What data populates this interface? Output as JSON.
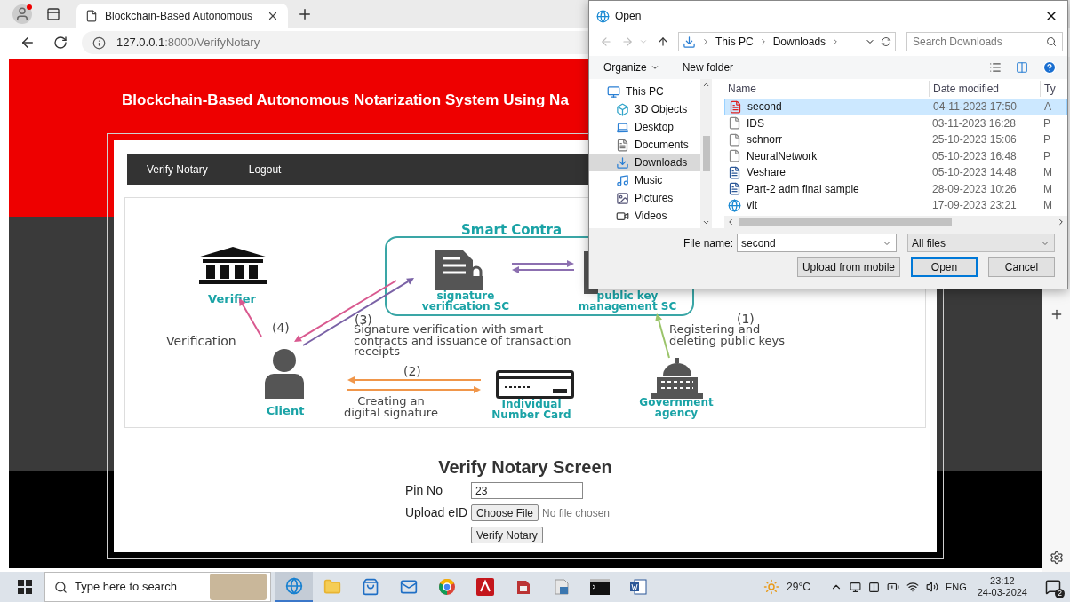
{
  "browser": {
    "tab": {
      "title": "Blockchain-Based Autonomous"
    },
    "url": {
      "host": "127.0.0.1",
      "path": ":8000/VerifyNotary"
    }
  },
  "page": {
    "title": "Blockchain-Based Autonomous Notarization System Using Na",
    "nav": [
      {
        "label": "Verify Notary"
      },
      {
        "label": "Logout"
      }
    ],
    "diagram": {
      "smart_contract_title": "Smart Contra",
      "signature_sc": "signature verification SC",
      "public_key_sc": "public key management SC",
      "verifier": "Verifier",
      "verification": "Verification",
      "step_4": "(4)",
      "step_3": "(3)",
      "step_3_text": "Signature verification with smart contracts and issuance of transaction receipts",
      "step_1": "(1)",
      "step_1_text": "Registering and deleting public keys",
      "step_2": "(2)",
      "step_2_text": "Creating an digital signature",
      "client": "Client",
      "card": "Individual Number Card",
      "agency": "Government agency"
    },
    "form": {
      "heading": "Verify Notary Screen",
      "fields": [
        {
          "kind": "text",
          "label": "Pin No",
          "value": "23"
        },
        {
          "kind": "file",
          "label": "Upload eID",
          "button": "Choose File",
          "status": "No file chosen"
        }
      ],
      "submit": "Verify Notary"
    }
  },
  "dialog": {
    "title": "Open",
    "path": [
      "This PC",
      "Downloads"
    ],
    "search_placeholder": "Search Downloads",
    "organize": "Organize",
    "new_folder": "New folder",
    "places": [
      {
        "label": "This PC",
        "kind": "pc",
        "selected": false
      },
      {
        "label": "3D Objects",
        "kind": "cube",
        "selected": false
      },
      {
        "label": "Desktop",
        "kind": "desktop",
        "selected": false
      },
      {
        "label": "Documents",
        "kind": "documents",
        "selected": false
      },
      {
        "label": "Downloads",
        "kind": "download",
        "selected": true
      },
      {
        "label": "Music",
        "kind": "music",
        "selected": false
      },
      {
        "label": "Pictures",
        "kind": "pictures",
        "selected": false
      },
      {
        "label": "Videos",
        "kind": "videos",
        "selected": false
      }
    ],
    "columns": [
      "Name",
      "Date modified",
      "Ty"
    ],
    "files": [
      {
        "name": "second",
        "date": "04-11-2023 17:50",
        "type": "A",
        "kind": "pdf",
        "selected": true
      },
      {
        "name": "IDS",
        "date": "03-11-2023 16:28",
        "type": "P",
        "kind": "file",
        "selected": false
      },
      {
        "name": "schnorr",
        "date": "25-10-2023 15:06",
        "type": "P",
        "kind": "file",
        "selected": false
      },
      {
        "name": "NeuralNetwork",
        "date": "05-10-2023 16:48",
        "type": "P",
        "kind": "file",
        "selected": false
      },
      {
        "name": "Veshare",
        "date": "05-10-2023 14:48",
        "type": "M",
        "kind": "word",
        "selected": false
      },
      {
        "name": "Part-2 adm final sample",
        "date": "28-09-2023 10:26",
        "type": "M",
        "kind": "word",
        "selected": false
      },
      {
        "name": "vit",
        "date": "17-09-2023 23:21",
        "type": "M",
        "kind": "browser",
        "selected": false
      }
    ],
    "file_name_label": "File name:",
    "file_name": "second",
    "filter": "All files",
    "buttons": [
      {
        "label": "Upload from mobile",
        "default": false
      },
      {
        "label": "Open",
        "default": true
      },
      {
        "label": "Cancel",
        "default": false
      }
    ]
  },
  "taskbar": {
    "search_placeholder": "Type here to search",
    "apps": [
      {
        "kind": "browser",
        "active": true
      },
      {
        "kind": "folder",
        "active": false
      },
      {
        "kind": "store",
        "active": false
      },
      {
        "kind": "mail",
        "active": false
      },
      {
        "kind": "globe",
        "active": false
      },
      {
        "kind": "pdf",
        "active": false
      },
      {
        "kind": "docapp",
        "active": false
      },
      {
        "kind": "script",
        "active": false
      },
      {
        "kind": "terminal",
        "active": false
      },
      {
        "kind": "word",
        "active": false
      }
    ],
    "weather": "29°C",
    "language": "ENG",
    "time": "23:12",
    "date": "24-03-2024",
    "notifications": "2"
  }
}
